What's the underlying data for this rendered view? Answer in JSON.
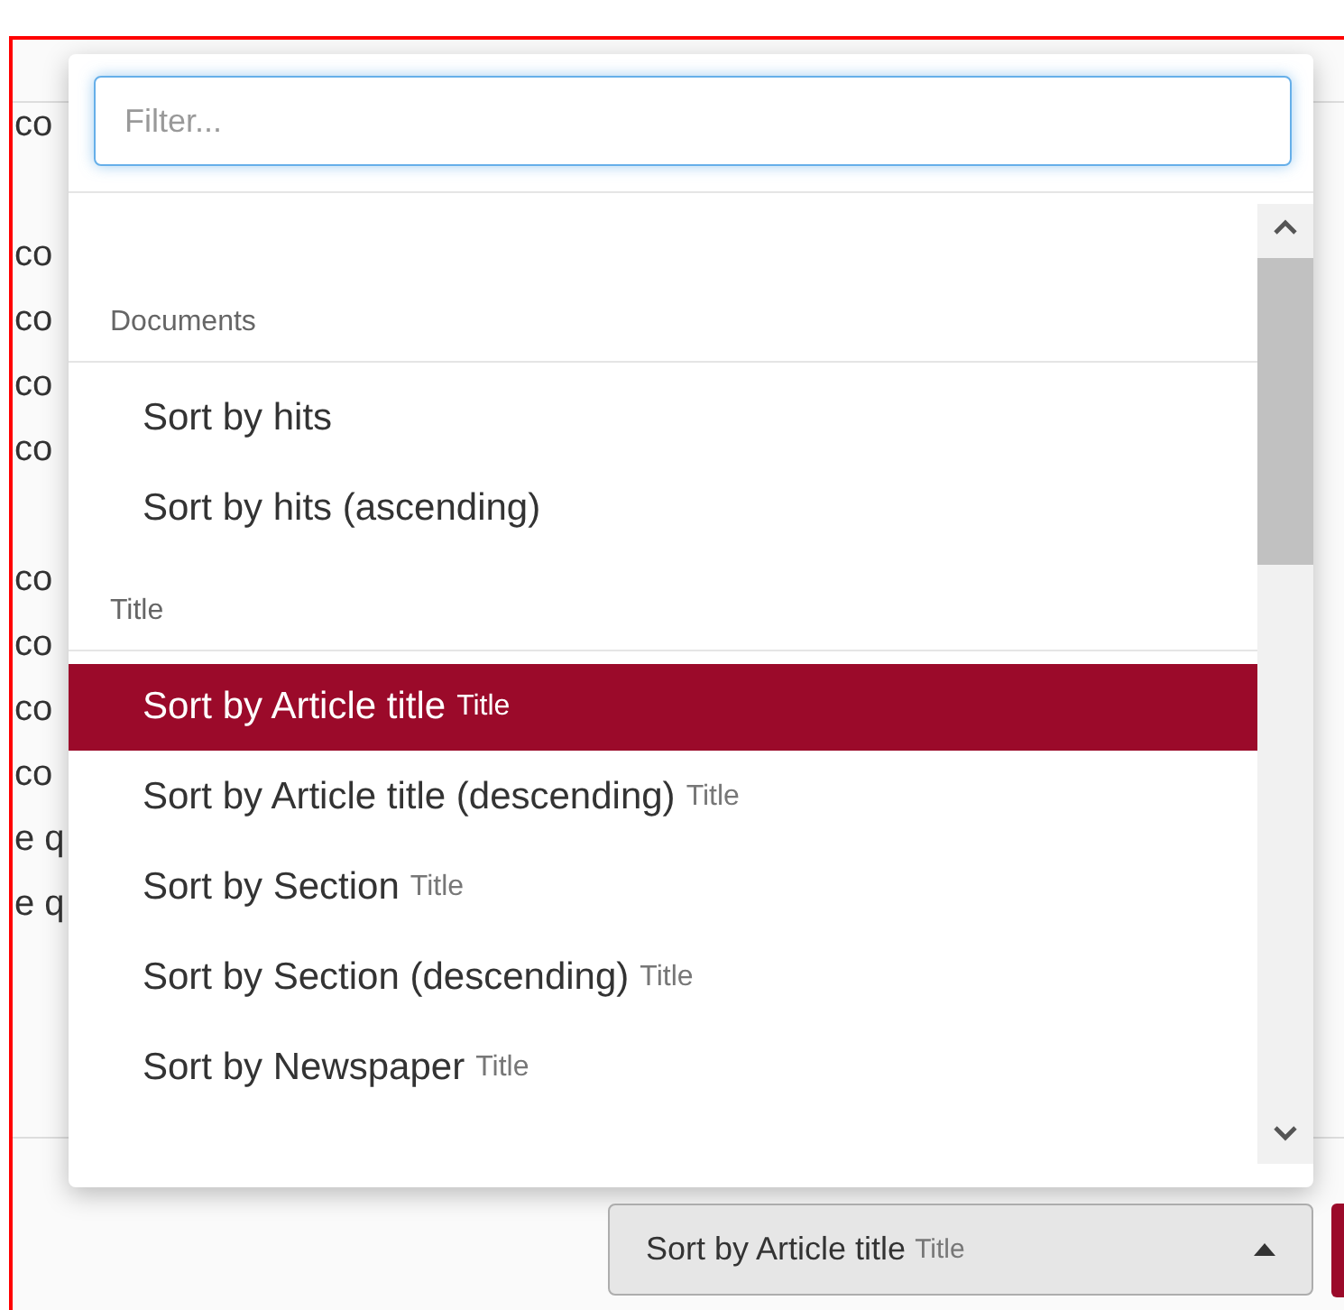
{
  "background": {
    "rows": [
      {
        "column_1": "co"
      },
      {},
      {
        "column_1": "co"
      },
      {
        "column_1": "co"
      },
      {
        "column_1": "co"
      },
      {
        "column_1": "co"
      },
      {},
      {
        "column_1": "co"
      },
      {
        "column_1": "co"
      },
      {
        "column_1": "co"
      },
      {
        "column_1": "co"
      },
      {
        "column_1": "e q"
      },
      {
        "column_1": "e q"
      }
    ]
  },
  "dropdown": {
    "filter": {
      "placeholder": "Filter..."
    },
    "groups": [
      {
        "label": "Documents",
        "items": [
          {
            "label": "Sort by hits",
            "selected": false
          },
          {
            "label": "Sort by hits (ascending)",
            "selected": false
          }
        ]
      },
      {
        "label": "Title",
        "items": [
          {
            "label": "Sort by Article title",
            "tag": "Title",
            "selected": true
          },
          {
            "label": "Sort by Article title (descending)",
            "tag": "Title",
            "selected": false
          },
          {
            "label": "Sort by Section",
            "tag": "Title",
            "selected": false
          },
          {
            "label": "Sort by Section (descending)",
            "tag": "Title",
            "selected": false
          },
          {
            "label": "Sort by Newspaper",
            "tag": "Title",
            "selected": false
          }
        ]
      }
    ]
  },
  "sort_button": {
    "label": "Sort by Article title",
    "tag": "Title"
  }
}
